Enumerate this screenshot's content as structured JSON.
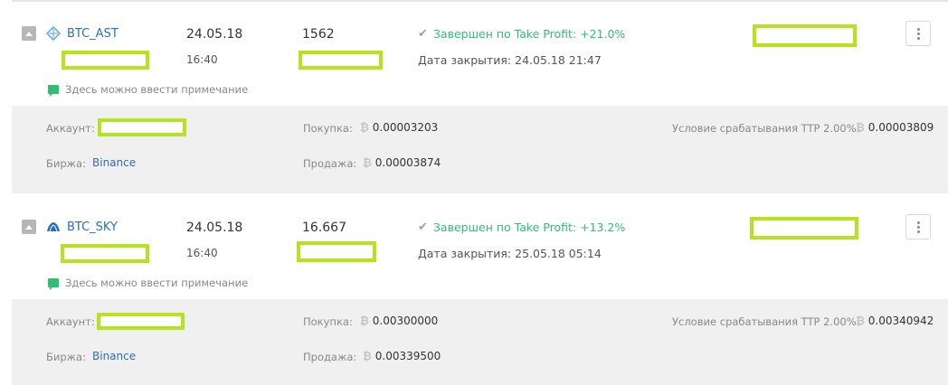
{
  "trades": [
    {
      "pair": "BTC_AST",
      "date": "24.05.18",
      "time": "16:40",
      "amount": "1562",
      "status": "Завершен по Take Profit: +21.0%",
      "close_date": "Дата закрытия: 24.05.18 21:47",
      "note_placeholder": "Здесь можно ввести примечание",
      "account_label": "Аккаунт:",
      "exchange_label": "Биржа:",
      "exchange": "Binance",
      "buy_label": "Покупка:",
      "buy_price": "0.00003203",
      "sell_label": "Продажа:",
      "sell_price": "0.00003874",
      "ttp_label": "Условие срабатывания TTP 2.00%:",
      "ttp_value": "0.00003809"
    },
    {
      "pair": "BTC_SKY",
      "date": "24.05.18",
      "time": "16:40",
      "amount": "16.667",
      "status": "Завершен по Take Profit: +13.2%",
      "close_date": "Дата закрытия: 25.05.18 05:14",
      "note_placeholder": "Здесь можно ввести примечание",
      "account_label": "Аккаунт:",
      "exchange_label": "Биржа:",
      "exchange": "Binance",
      "buy_label": "Покупка:",
      "buy_price": "0.00300000",
      "sell_label": "Продажа:",
      "sell_price": "0.00339500",
      "ttp_label": "Условие срабатывания TTP 2.00%:",
      "ttp_value": "0.00340942"
    }
  ],
  "icons": {
    "collapse": "collapse-icon",
    "ast_coin": "ast-coin-icon",
    "sky_coin": "sky-coin-icon",
    "check": "check-icon",
    "note": "comment-icon",
    "btc": "bitcoin-icon",
    "menu": "more-vertical-icon"
  },
  "colors": {
    "accent_link": "#2a6fb8",
    "status_success": "#2fbf71",
    "redaction": "#b6e31f",
    "details_bg": "#f0f0f0"
  }
}
